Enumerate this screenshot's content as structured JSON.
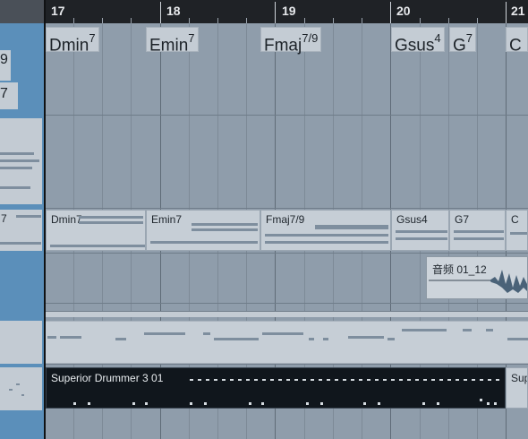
{
  "ruler": {
    "bars": [
      {
        "label": "17"
      },
      {
        "label": "18"
      },
      {
        "label": "19"
      },
      {
        "label": "20"
      },
      {
        "label": "21"
      }
    ]
  },
  "chord_track": {
    "chords": [
      {
        "root": "Dmin",
        "ext": "7"
      },
      {
        "root": "Emin",
        "ext": "7"
      },
      {
        "root": "Fmaj",
        "ext": "7/9"
      },
      {
        "root": "Gsus",
        "ext": "4"
      },
      {
        "root": "G",
        "ext": "7"
      },
      {
        "root": "C",
        "ext": ""
      }
    ],
    "left_partial": [
      {
        "ext": "9"
      },
      {
        "ext": "7"
      }
    ]
  },
  "chord_part": {
    "left_partial_label": "7",
    "labels": [
      "Dmin7",
      "Emin7",
      "Fmaj7/9",
      "Gsus4",
      "G7",
      "C"
    ]
  },
  "audio_event": {
    "name": "音频 01_12"
  },
  "drum_part": {
    "name": "Superior Drummer 3 01",
    "next_name": "Sup"
  },
  "colors": {
    "selection": "#5b8fba",
    "drum_bg": "#10161c",
    "ruler_bg": "#1f2226"
  }
}
